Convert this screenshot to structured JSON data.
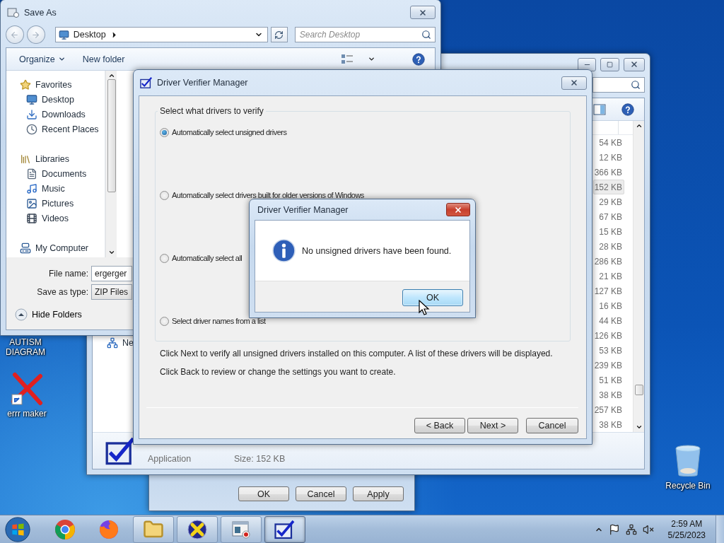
{
  "desktop_icons": [
    {
      "label": "AUTISM DIAGRAM",
      "kind": "covered"
    },
    {
      "label": "errr maker",
      "kind": "error-x"
    },
    {
      "label": "Recycle Bin",
      "kind": "recycle-bin"
    }
  ],
  "properties_window": {
    "buttons": [
      "OK",
      "Cancel",
      "Apply"
    ]
  },
  "explorer": {
    "nav_items": [
      {
        "label": "Ne",
        "kind": "network"
      }
    ],
    "sizes": [
      {
        "size": "54 KB",
        "selected": false
      },
      {
        "size": "12 KB",
        "selected": false
      },
      {
        "size": "366 KB",
        "selected": false
      },
      {
        "size": "152 KB",
        "selected": true
      },
      {
        "size": "29 KB",
        "selected": false
      },
      {
        "size": "67 KB",
        "selected": false
      },
      {
        "size": "15 KB",
        "selected": false
      },
      {
        "size": "28 KB",
        "selected": false
      },
      {
        "size": "286 KB",
        "selected": false
      },
      {
        "size": "21 KB",
        "selected": false
      },
      {
        "size": "127 KB",
        "selected": false
      },
      {
        "size": "16 KB",
        "selected": false
      },
      {
        "size": "44 KB",
        "selected": false
      },
      {
        "size": "126 KB",
        "selected": false
      },
      {
        "size": "53 KB",
        "selected": false
      },
      {
        "size": "239 KB",
        "selected": false
      },
      {
        "size": "51 KB",
        "selected": false
      },
      {
        "size": "38 KB",
        "selected": false
      },
      {
        "size": "257 KB",
        "selected": false
      },
      {
        "size": "38 KB",
        "selected": false
      }
    ],
    "details": {
      "type": "Application",
      "size": "Size: 152 KB"
    }
  },
  "save_as": {
    "title": "Save As",
    "address": "Desktop",
    "search": {
      "placeholder": "Search Desktop"
    },
    "toolbar": [
      {
        "label": "Organize",
        "kind": "menu"
      },
      {
        "label": "New folder",
        "kind": "button"
      }
    ],
    "nav": [
      {
        "label": "Favorites",
        "kind": "star",
        "children": [
          {
            "label": "Desktop",
            "kind": "desktop"
          },
          {
            "label": "Downloads",
            "kind": "downloads"
          },
          {
            "label": "Recent Places",
            "kind": "recent"
          }
        ]
      },
      {
        "label": "Libraries",
        "kind": "libraries",
        "children": [
          {
            "label": "Documents",
            "kind": "documents"
          },
          {
            "label": "Music",
            "kind": "music"
          },
          {
            "label": "Pictures",
            "kind": "pictures"
          },
          {
            "label": "Videos",
            "kind": "videos"
          }
        ]
      },
      {
        "label": "My Computer",
        "kind": "computer"
      }
    ],
    "file_name": {
      "label": "File name:",
      "value": "ergerger"
    },
    "save_as_type": {
      "label": "Save as type:",
      "value": "ZIP Files"
    },
    "hide_folders": "Hide Folders"
  },
  "verifier": {
    "title": "Driver Verifier Manager",
    "group_label": "Select what drivers to verify",
    "options": [
      {
        "label": "Automatically select unsigned drivers",
        "selected": true
      },
      {
        "label": "Automatically select drivers built for older versions of Windows",
        "selected": false
      },
      {
        "label": "Automatically select all",
        "selected": false
      },
      {
        "label": "Select driver names from a list",
        "selected": false
      }
    ],
    "notes": [
      "Click Next to verify all unsigned drivers installed on this computer. A list of these drivers will be displayed.",
      "Click Back to review or change the settings you want to create."
    ],
    "buttons": [
      "< Back",
      "Next >",
      "Cancel"
    ]
  },
  "message_box": {
    "title": "Driver Verifier Manager",
    "message": "No unsigned drivers have been found.",
    "button": {
      "label": "OK",
      "focused": true
    }
  },
  "taskbar": {
    "buttons": [
      {
        "kind": "chrome",
        "running": false,
        "selected": false
      },
      {
        "kind": "firefox",
        "running": false,
        "selected": false
      },
      {
        "kind": "folder",
        "running": true,
        "selected": false
      },
      {
        "kind": "x-app",
        "running": true,
        "selected": false
      },
      {
        "kind": "window-app",
        "running": true,
        "selected": false
      },
      {
        "kind": "verifier",
        "running": true,
        "selected": true
      }
    ],
    "time": "2:59 AM",
    "date": "5/25/2023"
  }
}
